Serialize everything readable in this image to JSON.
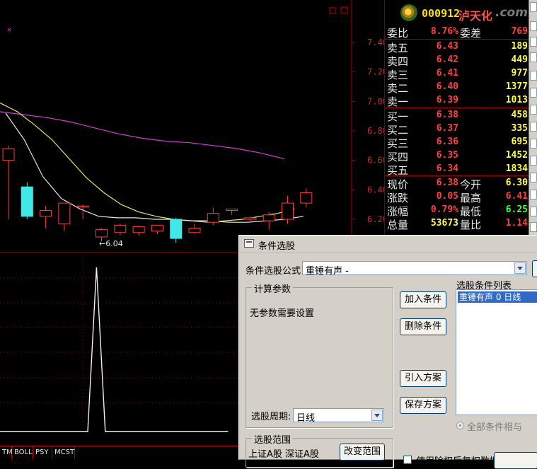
{
  "chart_data": {
    "type": "candlestick",
    "candles": [
      {
        "open": 6.6,
        "close": 6.68,
        "high": 6.7,
        "low": 6.2
      },
      {
        "open": 6.42,
        "close": 6.22,
        "high": 6.45,
        "low": 6.2
      },
      {
        "open": 6.22,
        "close": 6.26,
        "high": 6.29,
        "low": 6.14
      },
      {
        "open": 6.17,
        "close": 6.31,
        "high": 6.31,
        "low": 6.12
      },
      {
        "open": 6.29,
        "close": 6.29,
        "high": 6.3,
        "low": 6.2
      },
      {
        "open": 6.08,
        "close": 6.13,
        "high": 6.14,
        "low": 6.05
      },
      {
        "open": 6.11,
        "close": 6.16,
        "high": 6.17,
        "low": 6.09
      },
      {
        "open": 6.11,
        "close": 6.15,
        "high": 6.16,
        "low": 6.09
      },
      {
        "open": 6.12,
        "close": 6.16,
        "high": 6.16,
        "low": 6.1
      },
      {
        "open": 6.2,
        "close": 6.07,
        "high": 6.21,
        "low": 6.04
      },
      {
        "open": 6.11,
        "close": 6.14,
        "high": 6.17,
        "low": 6.1
      },
      {
        "open": 6.18,
        "close": 6.24,
        "high": 6.28,
        "low": 6.16
      },
      {
        "open": 6.26,
        "close": 6.27,
        "high": 6.27,
        "low": 6.23
      },
      {
        "open": 6.2,
        "close": 6.21,
        "high": 6.22,
        "low": 6.19
      },
      {
        "open": 6.19,
        "close": 6.23,
        "high": 6.25,
        "low": 6.13
      },
      {
        "open": 6.2,
        "close": 6.31,
        "high": 6.36,
        "low": 6.17
      },
      {
        "open": 6.31,
        "close": 6.38,
        "high": 6.41,
        "low": 6.28
      }
    ],
    "ma_yellow": [
      6.99,
      6.93,
      6.84,
      6.74,
      6.61,
      6.48,
      6.38,
      6.3,
      6.25,
      6.22,
      6.2,
      6.19,
      6.18,
      6.19,
      6.2,
      6.22,
      6.24,
      6.27
    ],
    "ma_white": [
      6.92,
      6.74,
      6.49,
      6.34,
      6.27,
      6.22,
      6.21,
      6.21,
      6.2,
      6.2,
      6.19,
      6.19,
      6.18,
      6.18,
      6.19,
      6.2,
      6.22
    ],
    "ma_magenta": [
      6.93,
      6.91,
      6.89,
      6.86,
      6.82,
      6.78,
      6.75,
      6.73,
      6.72,
      6.7,
      6.68,
      6.65,
      6.61
    ],
    "price_axis": {
      "ticks": [
        "7.40",
        "7.20",
        "7.00",
        "6.80",
        "6.60",
        "6.40",
        "6.20"
      ],
      "min": 6.1,
      "max": 7.45
    },
    "low_annotation": "←6.04",
    "indicator": {
      "values": [
        0,
        0,
        0,
        0,
        0,
        0,
        0,
        0,
        0,
        0,
        0,
        1,
        0,
        0,
        0,
        0,
        0,
        0,
        0,
        0,
        0,
        0,
        0,
        0,
        0,
        0,
        0
      ]
    }
  },
  "quote": {
    "code": "000912",
    "name": "泸天化",
    "watermark": ".com",
    "wb_label": "委比",
    "wb_value": "8.76%",
    "wc_label": "委差",
    "wc_value": "769",
    "asks": [
      {
        "label": "卖五",
        "price": "6.43",
        "vol": "189"
      },
      {
        "label": "卖四",
        "price": "6.42",
        "vol": "449"
      },
      {
        "label": "卖三",
        "price": "6.41",
        "vol": "977"
      },
      {
        "label": "卖二",
        "price": "6.40",
        "vol": "1377"
      },
      {
        "label": "卖一",
        "price": "6.39",
        "vol": "1013"
      }
    ],
    "bids": [
      {
        "label": "买一",
        "price": "6.38",
        "vol": "458"
      },
      {
        "label": "买二",
        "price": "6.37",
        "vol": "335"
      },
      {
        "label": "买三",
        "price": "6.36",
        "vol": "695"
      },
      {
        "label": "买四",
        "price": "6.35",
        "vol": "1452"
      },
      {
        "label": "买五",
        "price": "6.34",
        "vol": "1834"
      }
    ],
    "stats": [
      {
        "l1": "现价",
        "v1": "6.38",
        "c1": "#ff4040",
        "l2": "今开",
        "v2": "6.30",
        "c2": "#ffff40"
      },
      {
        "l1": "涨跌",
        "v1": "0.05",
        "c1": "#ff4040",
        "l2": "最高",
        "v2": "6.41",
        "c2": "#ff4040"
      },
      {
        "l1": "涨幅",
        "v1": "0.79%",
        "c1": "#ff4040",
        "l2": "最低",
        "v2": "6.25",
        "c2": "#40ff40"
      },
      {
        "l1": "总量",
        "v1": "53673",
        "c1": "#ffff40",
        "l2": "量比",
        "v2": "1.14",
        "c2": "#ff4040"
      }
    ]
  },
  "tabs": [
    "TM",
    "BOLL",
    "PSY",
    "MCST"
  ],
  "dialog": {
    "title": "条件选股",
    "formula_label": "条件选股公式",
    "formula_value": "重锤有声 -",
    "params_group": "计算参数",
    "params_text": "无参数需要设置",
    "period_label": "选股周期:",
    "period_value": "日线",
    "range_group": "选股范围",
    "range_text": "上证A股  深证A股",
    "change_range_btn": "改变范围",
    "add_btn": "加入条件",
    "delete_btn": "删除条件",
    "import_btn": "引入方案",
    "save_btn": "保存方案",
    "list_title": "选股条件列表",
    "list_item": "重锤有声  0  日线",
    "all_and_label": "全部条件相与",
    "use_adjust_label": "使用除权后复权数据"
  }
}
